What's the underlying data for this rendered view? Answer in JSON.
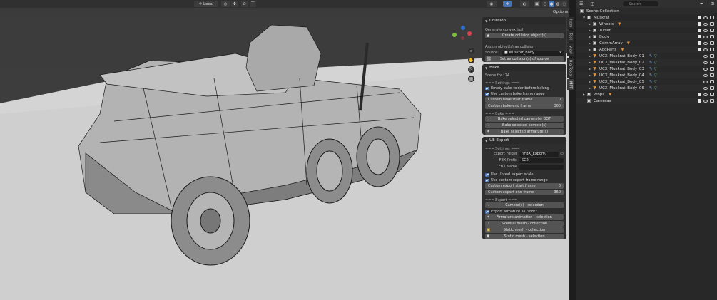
{
  "viewport_header": {
    "orientation": "Local",
    "options_label": "Options"
  },
  "collision_panel": {
    "title": "Collision",
    "generate_label": "Generate convex hull",
    "create_button": "Create collision object(s)",
    "assign_label": "Assign object(s) as collision",
    "source_label": "Source:",
    "source_value": "Muskrat_Body",
    "set_button": "Set as collision(s) of source"
  },
  "bake_panel": {
    "title": "Bake",
    "scene_fps": "Scene fps: 24",
    "settings_label": "=== Settings ===",
    "empty_folder": "Empty bake folder before baking",
    "use_custom_range": "Use custom bake frame range",
    "start_label": "Custom bake start frame",
    "start_value": "0",
    "end_label": "Custom bake end frame",
    "end_value": "360",
    "bake_label": "=== Bake ===",
    "bake_camera_dof": "Bake selected camera(s) DOF",
    "bake_cameras": "Bake selected camera(s)",
    "bake_armatures": "Bake selected armature(s)"
  },
  "ue_export_panel": {
    "title": "UE Export",
    "settings_label": "=== Settings ===",
    "export_folder_label": "Export Folder",
    "export_folder_value": "//FBX_Export\\",
    "fbx_prefix_label": "FBX Prefix",
    "fbx_prefix_value": "SC2_",
    "fbx_name_label": "FBX Name",
    "fbx_name_value": "",
    "use_unreal_scale": "Use Unreal export scale",
    "use_custom_range": "Use custom export frame range",
    "start_label": "Custom export start frame",
    "start_value": "0",
    "end_label": "Custom export end frame",
    "end_value": "360",
    "export_label": "=== Export ===",
    "cameras_selection": "Camera(s) - selection",
    "export_armature_root": "Export armature as \"root\"",
    "armature_anim": "Armature animation - selection",
    "skeletal_mesh": "Skeletal mesh - collection",
    "static_mesh_collection": "Static mesh - collection",
    "static_mesh_selection": "Static mesh - selection"
  },
  "side_tabs": [
    "Item",
    "Tool",
    "View",
    "Rig Tools",
    "MPT"
  ],
  "outliner": {
    "search_placeholder": "Search",
    "rows": [
      {
        "label": "Scene Collection",
        "indent": 0
      },
      {
        "label": "Muskrat",
        "indent": 1
      },
      {
        "label": "Wheels",
        "indent": 2
      },
      {
        "label": "Turret",
        "indent": 2
      },
      {
        "label": "Body",
        "indent": 2
      },
      {
        "label": "CommArray",
        "indent": 2
      },
      {
        "label": "AddParts",
        "indent": 2
      },
      {
        "label": "UCX_Muskrat_Body_01",
        "indent": 2
      },
      {
        "label": "UCX_Muskrat_Body_02",
        "indent": 2
      },
      {
        "label": "UCX_Muskrat_Body_03",
        "indent": 2
      },
      {
        "label": "UCX_Muskrat_Body_04",
        "indent": 2
      },
      {
        "label": "UCX_Muskrat_Body_05",
        "indent": 2
      },
      {
        "label": "UCX_Muskrat_Body_06",
        "indent": 2
      },
      {
        "label": "Props",
        "indent": 1
      },
      {
        "label": "Cameras",
        "indent": 1
      }
    ]
  },
  "colors": {
    "accent_blue": "#4772b3",
    "orange": "#e0913a",
    "green": "#66c48f"
  }
}
